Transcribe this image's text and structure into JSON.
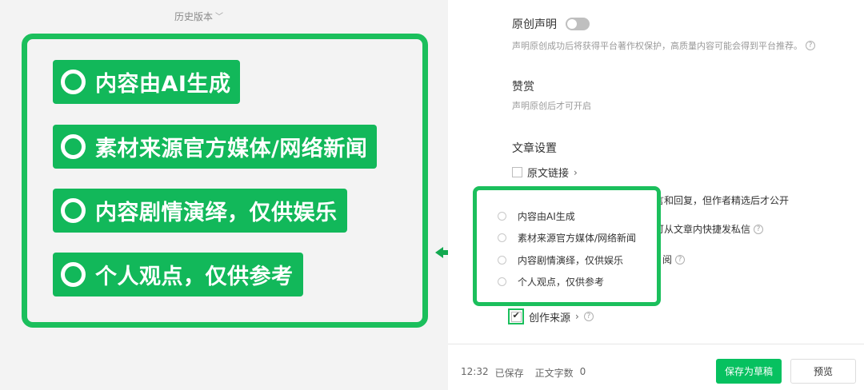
{
  "history": {
    "label": "历史版本"
  },
  "highlight_tags": [
    "内容由AI生成",
    "素材来源官方媒体/网络新闻",
    "内容剧情演绎，仅供娱乐",
    "个人观点，仅供参考"
  ],
  "original": {
    "title": "原创声明",
    "desc": "声明原创成功后将获得平台著作权保护，高质量内容可能会得到平台推荐。"
  },
  "reward": {
    "title": "赞赏",
    "desc": "声明原创后才可开启"
  },
  "article_settings": {
    "title": "文章设置",
    "source_link": "原文链接",
    "comment_partial": "言和回复，但作者精选后才公开",
    "message_partial": "可从文章内快捷发私信",
    "read_partial": "阅"
  },
  "popup": {
    "options": [
      "内容由AI生成",
      "素材来源官方媒体/网络新闻",
      "内容剧情演绎，仅供娱乐",
      "个人观点，仅供参考"
    ]
  },
  "creation_source": {
    "label": "创作来源",
    "checked": true
  },
  "footer": {
    "time": "12:32",
    "saved": "已保存",
    "word_count_label": "正文字数",
    "word_count": "0",
    "save_draft": "保存为草稿",
    "preview": "预览"
  },
  "colors": {
    "green": "#07c160",
    "tag_green": "#12b85a",
    "frame_green": "#1bbf5c"
  }
}
